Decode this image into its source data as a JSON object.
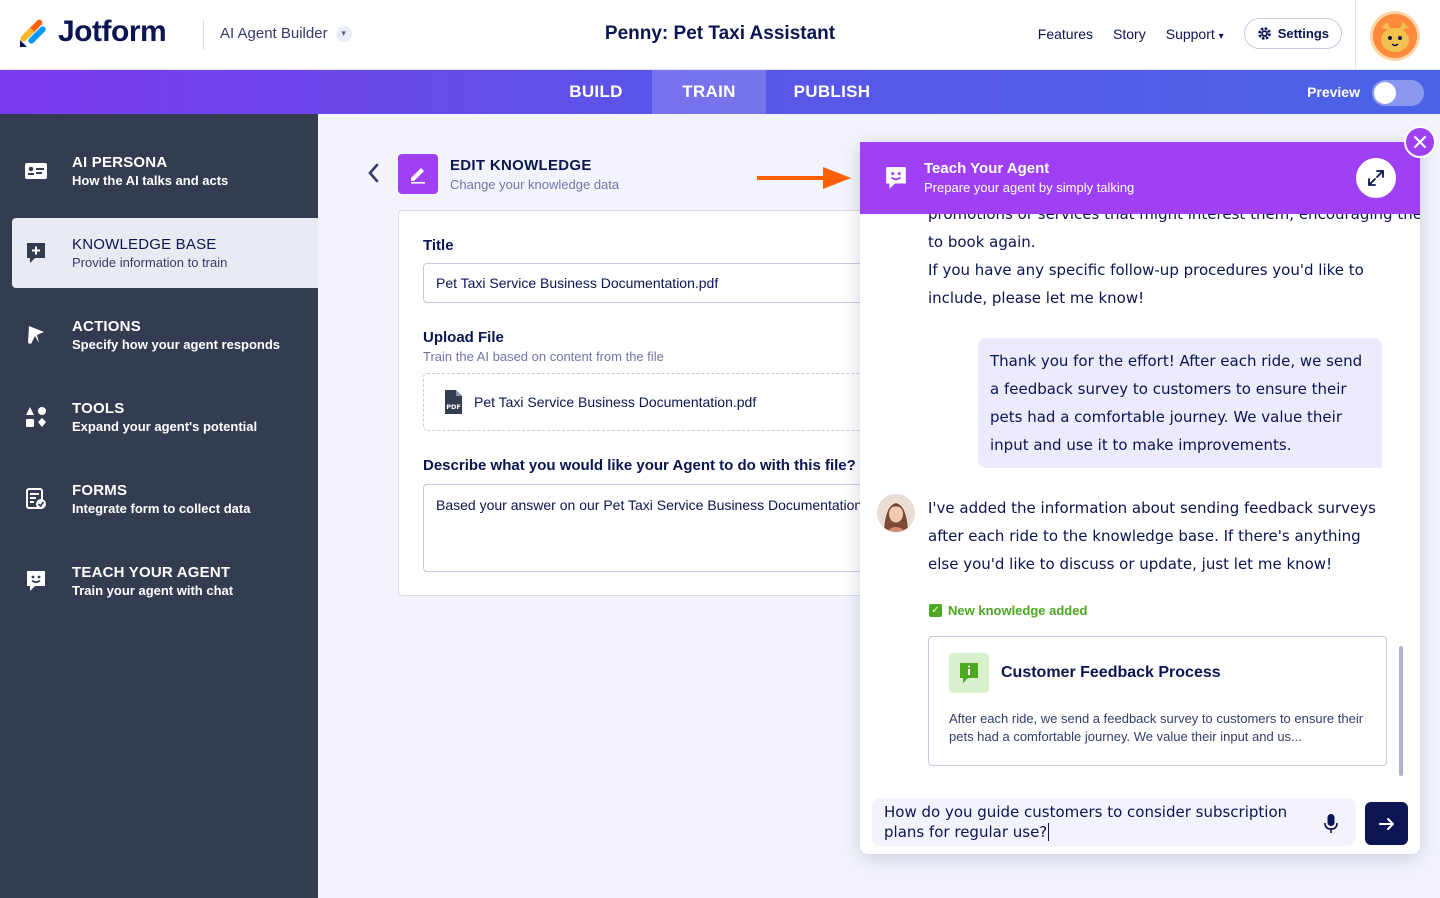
{
  "header": {
    "logo_text": "Jotform",
    "product": "AI Agent Builder",
    "agent_title": "Penny: Pet Taxi Assistant",
    "nav": [
      "Features",
      "Story",
      "Support"
    ],
    "settings_label": "Settings"
  },
  "tabs": {
    "build": "BUILD",
    "train": "TRAIN",
    "publish": "PUBLISH",
    "preview_label": "Preview"
  },
  "sidebar": {
    "items": [
      {
        "title": "AI PERSONA",
        "desc": "How the AI talks and acts"
      },
      {
        "title": "KNOWLEDGE BASE",
        "desc": "Provide information to train"
      },
      {
        "title": "ACTIONS",
        "desc": "Specify how your agent responds"
      },
      {
        "title": "TOOLS",
        "desc": "Expand your agent's potential"
      },
      {
        "title": "FORMS",
        "desc": "Integrate form to collect data"
      },
      {
        "title": "TEACH YOUR AGENT",
        "desc": "Train your agent with chat"
      }
    ]
  },
  "edit": {
    "title": "EDIT KNOWLEDGE",
    "subtitle": "Change your knowledge data",
    "title_label": "Title",
    "title_value": "Pet Taxi Service Business Documentation.pdf",
    "upload_label": "Upload File",
    "upload_help": "Train the AI based on content from the file",
    "upload_file": "Pet Taxi Service Business Documentation.pdf",
    "pdf_badge": "PDF",
    "describe_label": "Describe what you would like your Agent to do with this file?",
    "describe_value": "Based your answer on our Pet Taxi Service Business Documentation"
  },
  "teach": {
    "title": "Teach Your Agent",
    "subtitle": "Prepare your agent by simply talking",
    "messages": {
      "bot_1_line_a": "promotions or services that might interest them, encouraging them",
      "bot_1_line_b": "to book again.",
      "bot_1_line_c": "If you have any specific follow-up procedures you'd like to include, please let me know!",
      "user_1": "Thank you for the effort! After each ride, we send a feedback survey to customers to ensure their pets had a comfortable journey. We value their input and use it to make improvements.",
      "bot_2": "I've added the information about sending feedback surveys after each ride to the knowledge base. If there's anything else you'd like to discuss or update, just let me know!"
    },
    "new_knowledge_label": "New knowledge added",
    "knowledge_card": {
      "title": "Customer Feedback Process",
      "desc": "After each ride, we send a feedback survey to customers to ensure their pets had a comfortable journey. We value their input and us..."
    },
    "composer_value": "How do you guide customers to consider subscription plans for regular use?"
  },
  "colors": {
    "brand_navy": "#0a1551",
    "accent_purple": "#9f40f5",
    "sidebar_bg": "#343c52",
    "success_green": "#4ba81f",
    "arrow_orange": "#ff6100"
  }
}
